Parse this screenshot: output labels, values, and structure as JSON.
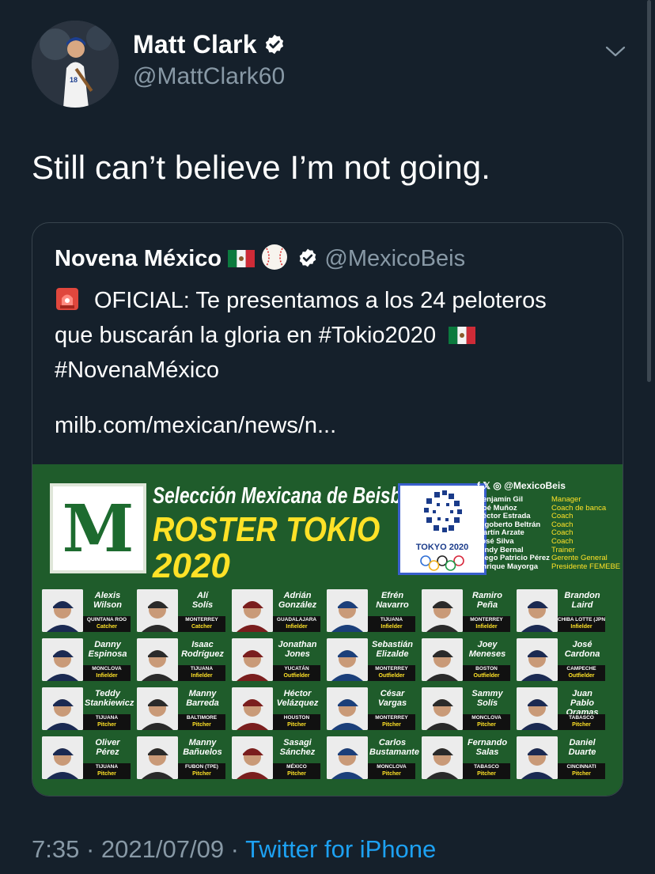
{
  "author": {
    "display_name": "Matt Clark",
    "handle": "@MattClark60"
  },
  "tweet": {
    "text": "Still can’t believe I’m not going."
  },
  "quote": {
    "display_name": "Novena México",
    "handle": "@MexicoBeis",
    "line1": "OFICIAL: Te presentamos a los 24 peloteros",
    "line2": "que buscarán la gloria en #Tokio2020",
    "line3": "#NovenaMéxico",
    "link": "milb.com/mexican/news/n..."
  },
  "roster_image": {
    "logo_letter": "M",
    "subtitle": "Selección Mexicana de Beisbol",
    "title_line1": "ROSTER TOKIO",
    "title_line2": "2020",
    "olympic_label": "TOKYO 2020",
    "social_handle": "f 𝕏 ◎ @MexicoBeis",
    "staff": [
      {
        "name": "Benjamín Gil",
        "role": "Manager"
      },
      {
        "name": "Noé Muñoz",
        "role": "Coach de banca"
      },
      {
        "name": "Héctor Estrada",
        "role": "Coach"
      },
      {
        "name": "Rigoberto Beltrán",
        "role": "Coach"
      },
      {
        "name": "Martín Arzate",
        "role": "Coach"
      },
      {
        "name": "José Silva",
        "role": "Coach"
      },
      {
        "name": "Cindy Bernal",
        "role": "Trainer"
      },
      {
        "name": "Diego Patricio Pérez",
        "role": "Gerente General"
      },
      {
        "name": "Enrique Mayorga",
        "role": "Presidente FEMEBE"
      }
    ],
    "players": [
      {
        "first": "Alexis",
        "last": "Wilson",
        "team": "QUINTANA ROO",
        "pos": "Catcher"
      },
      {
        "first": "Alí",
        "last": "Solís",
        "team": "MONTERREY",
        "pos": "Catcher"
      },
      {
        "first": "Adrián",
        "last": "González",
        "team": "GUADALAJARA",
        "pos": "Infielder"
      },
      {
        "first": "Efrén",
        "last": "Navarro",
        "team": "TIJUANA",
        "pos": "Infielder"
      },
      {
        "first": "Ramiro",
        "last": "Peña",
        "team": "MONTERREY",
        "pos": "Infielder"
      },
      {
        "first": "Brandon",
        "last": "Laird",
        "team": "CHIBA LOTTE (JPN)",
        "pos": "Infielder"
      },
      {
        "first": "Danny",
        "last": "Espinosa",
        "team": "MONCLOVA",
        "pos": "Infielder"
      },
      {
        "first": "Isaac",
        "last": "Rodríguez",
        "team": "TIJUANA",
        "pos": "Infielder"
      },
      {
        "first": "Jonathan",
        "last": "Jones",
        "team": "YUCATÁN",
        "pos": "Outfielder"
      },
      {
        "first": "Sebastián",
        "last": "Elizalde",
        "team": "MONTERREY",
        "pos": "Outfielder"
      },
      {
        "first": "Joey",
        "last": "Meneses",
        "team": "BOSTON",
        "pos": "Outfielder"
      },
      {
        "first": "José",
        "last": "Cardona",
        "team": "CAMPECHE",
        "pos": "Outfielder"
      },
      {
        "first": "Teddy",
        "last": "Stankiewicz",
        "team": "TIJUANA",
        "pos": "Pitcher"
      },
      {
        "first": "Manny",
        "last": "Barreda",
        "team": "BALTIMORE",
        "pos": "Pitcher"
      },
      {
        "first": "Héctor",
        "last": "Velázquez",
        "team": "HOUSTON",
        "pos": "Pitcher"
      },
      {
        "first": "César",
        "last": "Vargas",
        "team": "MONTERREY",
        "pos": "Pitcher"
      },
      {
        "first": "Sammy",
        "last": "Solís",
        "team": "MONCLOVA",
        "pos": "Pitcher"
      },
      {
        "first": "Juan Pablo",
        "last": "Oramas",
        "team": "TABASCO",
        "pos": "Pitcher"
      },
      {
        "first": "Oliver",
        "last": "Pérez",
        "team": "TIJUANA",
        "pos": "Pitcher"
      },
      {
        "first": "Manny",
        "last": "Bañuelos",
        "team": "FUBON (TPE)",
        "pos": "Pitcher"
      },
      {
        "first": "Sasagi",
        "last": "Sánchez",
        "team": "MÉXICO",
        "pos": "Pitcher"
      },
      {
        "first": "Carlos",
        "last": "Bustamante",
        "team": "MONCLOVA",
        "pos": "Pitcher"
      },
      {
        "first": "Fernando",
        "last": "Salas",
        "team": "TABASCO",
        "pos": "Pitcher"
      },
      {
        "first": "Daniel",
        "last": "Duarte",
        "team": "CINCINNATI",
        "pos": "Pitcher"
      }
    ]
  },
  "meta": {
    "time": "7:35",
    "separator": " · ",
    "date": "2021/07/09",
    "source": "Twitter for iPhone"
  },
  "colors": {
    "background": "#15202b",
    "secondary_text": "#8899a6",
    "link": "#1da1f2",
    "roster_green": "#1f5c2b",
    "roster_yellow": "#ffe227"
  },
  "icons": [
    "verified-badge-icon",
    "chevron-down-icon",
    "mexico-flag-icon",
    "baseball-icon",
    "siren-icon"
  ]
}
